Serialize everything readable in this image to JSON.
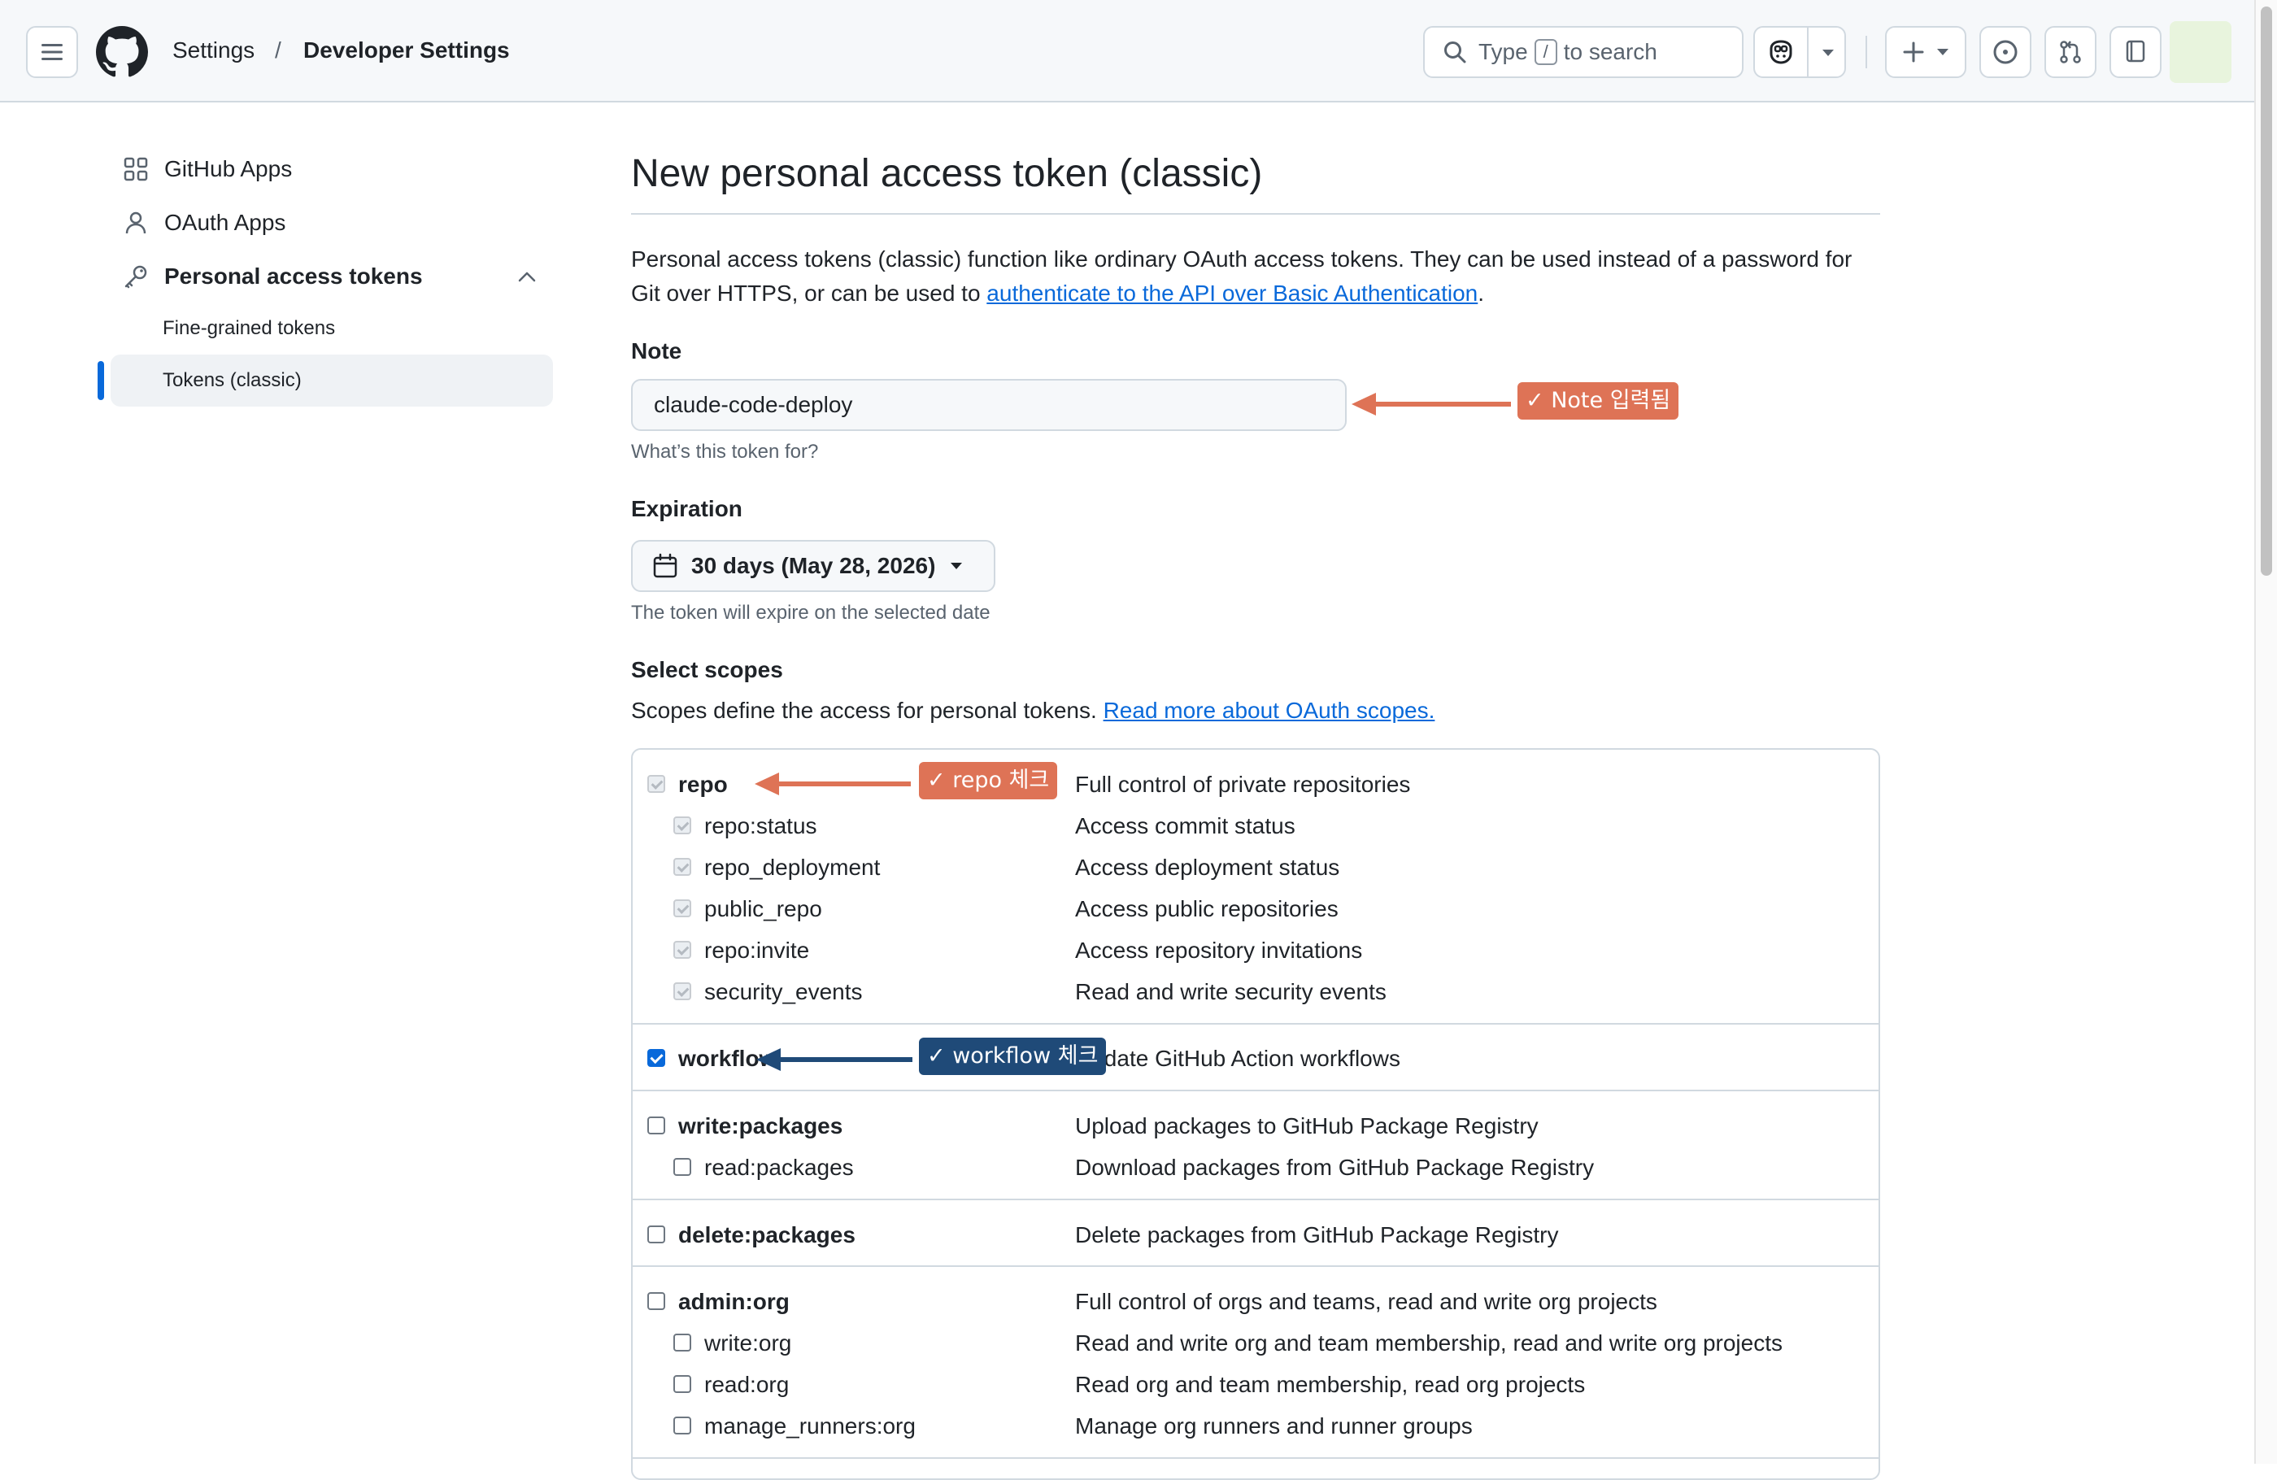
{
  "header": {
    "breadcrumb": [
      "Settings",
      "/",
      "Developer Settings"
    ],
    "search": {
      "prefix": "Type",
      "key": "/",
      "suffix": "to search"
    }
  },
  "sidebar": {
    "items": [
      {
        "label": "GitHub Apps",
        "icon": "apps-icon"
      },
      {
        "label": "OAuth Apps",
        "icon": "person-icon"
      },
      {
        "label": "Personal access tokens",
        "icon": "key-icon",
        "expanded": true
      }
    ],
    "subitems": [
      {
        "label": "Fine-grained tokens",
        "active": false
      },
      {
        "label": "Tokens (classic)",
        "active": true
      }
    ]
  },
  "page": {
    "title": "New personal access token (classic)",
    "intro_text": "Personal access tokens (classic) function like ordinary OAuth access tokens. They can be used instead of a password for Git over HTTPS, or can be used to",
    "intro_link": "authenticate to the API over Basic Authentication",
    "intro_end": "."
  },
  "note": {
    "label": "Note",
    "value": "claude-code-deploy",
    "hint": "What’s this token for?"
  },
  "expiration": {
    "label": "Expiration",
    "value": "30 days (May 28, 2026)",
    "hint": "The token will expire on the selected date"
  },
  "scopes": {
    "label": "Select scopes",
    "desc": "Scopes define the access for personal tokens.",
    "link": "Read more about OAuth scopes.",
    "groups": [
      {
        "name": "repo",
        "desc": "Full control of private repositories",
        "checked": true,
        "children": [
          {
            "name": "repo:status",
            "desc": "Access commit status"
          },
          {
            "name": "repo_deployment",
            "desc": "Access deployment status"
          },
          {
            "name": "public_repo",
            "desc": "Access public repositories"
          },
          {
            "name": "repo:invite",
            "desc": "Access repository invitations"
          },
          {
            "name": "security_events",
            "desc": "Read and write security events"
          }
        ]
      },
      {
        "name": "workflow",
        "desc": "Update GitHub Action workflows",
        "checked": true,
        "children": []
      },
      {
        "name": "write:packages",
        "desc": "Upload packages to GitHub Package Registry",
        "checked": false,
        "children": [
          {
            "name": "read:packages",
            "desc": "Download packages from GitHub Package Registry"
          }
        ]
      },
      {
        "name": "delete:packages",
        "desc": "Delete packages from GitHub Package Registry",
        "checked": false,
        "children": []
      },
      {
        "name": "admin:org",
        "desc": "Full control of orgs and teams, read and write org projects",
        "checked": false,
        "children": [
          {
            "name": "write:org",
            "desc": "Read and write org and team membership, read and write org projects"
          },
          {
            "name": "read:org",
            "desc": "Read org and team membership, read org projects"
          },
          {
            "name": "manage_runners:org",
            "desc": "Manage org runners and runner groups"
          }
        ]
      }
    ]
  },
  "annotations": {
    "note": "✓ Note 입력됨",
    "repo": "✓ repo 체크",
    "workflow": "✓ workflow 체크"
  },
  "colors": {
    "accent": "#0969da",
    "annotation_orange": "#de7356",
    "annotation_navy": "#1f4a78"
  }
}
